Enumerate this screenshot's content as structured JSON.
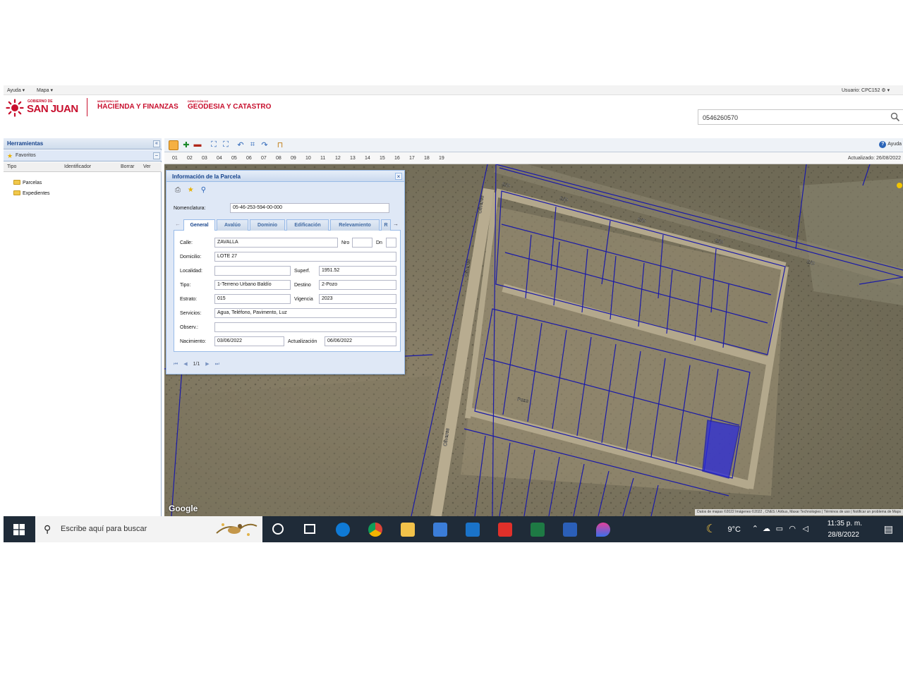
{
  "menubar": {
    "help": "Ayuda ▾",
    "maps": "Mapa ▾",
    "user": "Usuario: CPC152 ⚙ ▾"
  },
  "header": {
    "gov_small": "GOBIERNO DE",
    "gov_big": "SAN JUAN",
    "ministry_small": "MINISTERIO DE",
    "ministry": "HACIENDA Y FINANZAS",
    "direction_small": "DIRECCIÓN DE",
    "direction": "GEODESIA Y CATASTRO",
    "search_value": "0546260570"
  },
  "leftpanel": {
    "title": "Herramientas",
    "favorites": "Favoritos",
    "columns": [
      "Tipo",
      "Identificador",
      "Borrar",
      "Ver"
    ],
    "tree": [
      "Parcelas",
      "Expedientes"
    ]
  },
  "toolbar": {
    "help": "Ayuda",
    "updated": "Actualizado: 26/08/2022"
  },
  "zoom_levels": [
    "01",
    "02",
    "03",
    "04",
    "05",
    "06",
    "07",
    "08",
    "09",
    "10",
    "11",
    "12",
    "13",
    "14",
    "15",
    "16",
    "17",
    "18",
    "19"
  ],
  "map": {
    "google": "Google",
    "attribution": "Datos de mapas ©2022 Imágenes ©2022 , CNES / Airbus, Maxar Technologies  |  Términos de uso  |  Notificar un problema de Maps",
    "street_labels": [
      "Olivares",
      "Olivares",
      "Olivares",
      "S/D",
      "S/D",
      "S/D",
      "S/D",
      "S/D",
      "Pozo"
    ]
  },
  "popup": {
    "title": "Información de la Parcela",
    "nomenclatura_label": "Nomenclatura:",
    "nomenclatura": "05-46-253-594-00-000",
    "tabs": [
      "General",
      "Avalúo",
      "Dominio",
      "Edificación",
      "Relevamiento",
      "R"
    ],
    "fields": {
      "calle_label": "Calle:",
      "calle": "ZAVALLA",
      "nro_label": "Nro",
      "nro": "",
      "dn_label": "Dn",
      "dn": "",
      "domicilio_label": "Domicilio:",
      "domicilio": "LOTE 27",
      "localidad_label": "Localidad:",
      "localidad": "",
      "superf_label": "Superf.",
      "superf": "1951.52",
      "tipo_label": "Tipo:",
      "tipo": "1-Terreno Urbano Baldío",
      "destino_label": "Destino",
      "destino": "2-Pozo",
      "estrato_label": "Estrato:",
      "estrato": "015",
      "vigencia_label": "Vigencia",
      "vigencia": "2023",
      "servicios_label": "Servicios:",
      "servicios": "Agua, Teléfono, Pavimento, Luz",
      "observ_label": "Observ.:",
      "observ": "",
      "nacimiento_label": "Nacimiento:",
      "nacimiento": "03/06/2022",
      "actualizacion_label": "Actualización",
      "actualizacion": "06/06/2022"
    },
    "pager": "1/1"
  },
  "taskbar": {
    "search_placeholder": "Escribe aquí para buscar",
    "temperature": "9°C",
    "time": "11:35 p. m.",
    "date": "28/8/2022"
  },
  "colors": {
    "accent": "#c8102e",
    "parcel_line": "#1a1aa8",
    "selected_parcel": "#2a2ad8",
    "taskbar": "#1f2b38"
  }
}
